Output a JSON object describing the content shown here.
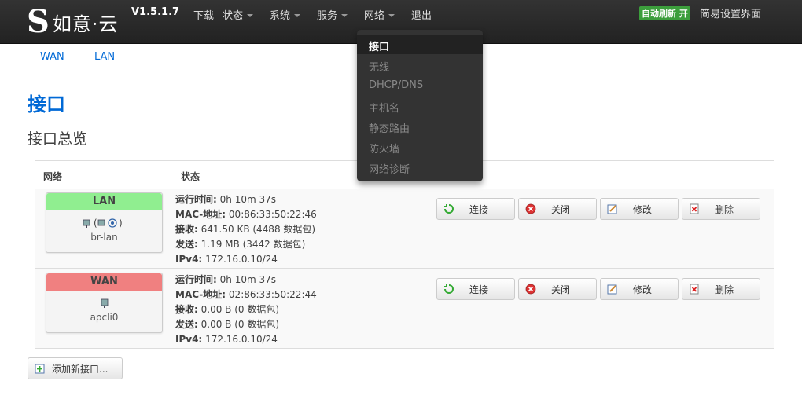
{
  "brand": {
    "logo_letter": "S",
    "name": "如意·云",
    "version": "V1.5.1.7"
  },
  "nav": {
    "download": "下载",
    "status": "状态",
    "system": "系统",
    "services": "服务",
    "network": "网络",
    "logout": "退出",
    "auto_refresh": "自动刷新 开",
    "simple_ui": "简易设置界面"
  },
  "network_menu": {
    "items": [
      "接口",
      "无线",
      "DHCP/DNS",
      "主机名",
      "静态路由",
      "防火墙",
      "网络诊断"
    ],
    "active": "接口"
  },
  "subtabs": [
    "WAN",
    "LAN"
  ],
  "page_title": "接口",
  "section_title": "接口总览",
  "table": {
    "headers": {
      "network": "网络",
      "status": "状态"
    },
    "rows": [
      {
        "network": "LAN",
        "iface": "br-lan",
        "status": {
          "uptime_label": "运行时间:",
          "uptime": "0h 10m 37s",
          "mac_label": "MAC-地址:",
          "mac": "00:86:33:50:22:46",
          "rx_label": "接收:",
          "rx": "641.50 KB (4488 数据包)",
          "tx_label": "发送:",
          "tx": "1.19 MB (3442 数据包)",
          "ipv4_label": "IPv4:",
          "ipv4": "172.16.0.10/24"
        },
        "head_color": "#90ee90"
      },
      {
        "network": "WAN",
        "iface": "apcli0",
        "status": {
          "uptime_label": "运行时间:",
          "uptime": "0h 10m 37s",
          "mac_label": "MAC-地址:",
          "mac": "02:86:33:50:22:44",
          "rx_label": "接收:",
          "rx": "0.00 B (0 数据包)",
          "tx_label": "发送:",
          "tx": "0.00 B (0 数据包)",
          "ipv4_label": "IPv4:",
          "ipv4": "172.16.0.10/24"
        },
        "head_color": "#f08080"
      }
    ],
    "actions": {
      "connect": "连接",
      "stop": "关闭",
      "edit": "修改",
      "delete": "删除"
    }
  },
  "add_interface": "添加新接口...",
  "colors": {
    "navbar": "#222222",
    "link": "#0069d6",
    "auto_refresh_bg": "#3c9e3c"
  },
  "icons": [
    "refresh-icon",
    "stop-icon",
    "edit-icon",
    "delete-icon",
    "add-icon",
    "ethernet-icon",
    "wireless-icon"
  ]
}
